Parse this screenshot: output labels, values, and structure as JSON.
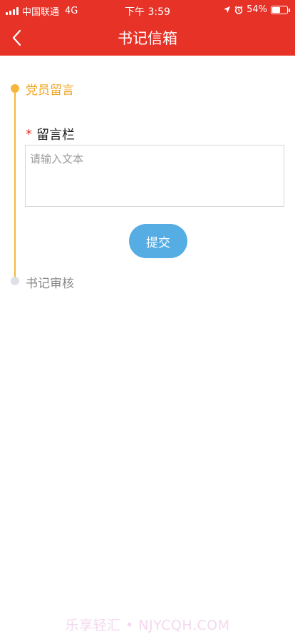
{
  "status_bar": {
    "carrier": "中国联通",
    "network": "4G",
    "time": "下午 3:59",
    "battery_percent": "54%",
    "battery_level": 0.54,
    "icons": [
      "signal-icon",
      "location-arrow-icon",
      "alarm-icon",
      "battery-icon"
    ]
  },
  "nav": {
    "back_icon": "chevron-left-icon",
    "title": "书记信箱"
  },
  "timeline": {
    "steps": [
      {
        "label": "党员留言",
        "state": "active"
      },
      {
        "label": "书记审核",
        "state": "inactive"
      }
    ]
  },
  "form": {
    "required_mark": "*",
    "field_label": "留言栏",
    "message_value": "",
    "message_placeholder": "请输入文本",
    "submit_label": "提交"
  },
  "watermark": "乐享轻汇 • NJYCQH.COM",
  "colors": {
    "header": "#e63227",
    "timeline_active": "#f5b73b",
    "timeline_inactive": "#dde0e6",
    "submit_button": "#56ade3",
    "required_mark": "#e63227"
  }
}
